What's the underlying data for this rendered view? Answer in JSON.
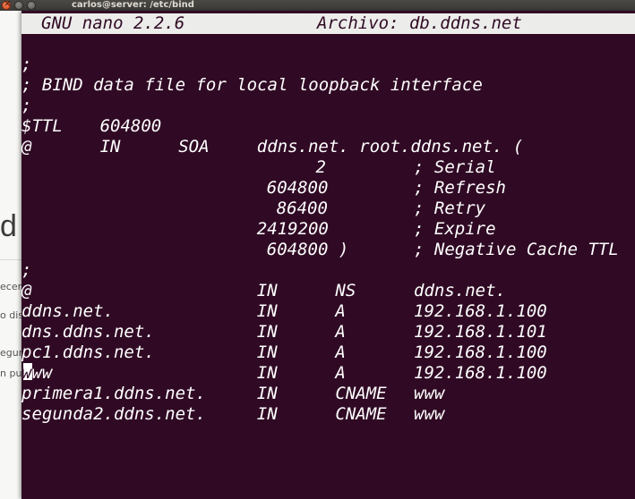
{
  "window": {
    "title": "carlos@server: /etc/bind"
  },
  "background_window": {
    "big_letter": "d",
    "fragments": [
      "ecen",
      "o dis",
      "egun",
      "n pu"
    ]
  },
  "nano": {
    "version": "GNU nano 2.2.6",
    "file_label": "Archivo: db.ddns.net"
  },
  "file_lines": [
    [
      {
        "t": ";",
        "c": 0
      }
    ],
    [
      {
        "t": "; BIND data file for local loopback interface",
        "c": 0
      }
    ],
    [
      {
        "t": ";",
        "c": 0
      }
    ],
    [
      {
        "t": "$TTL",
        "c": 0
      },
      {
        "t": "604800",
        "c": 8
      }
    ],
    [
      {
        "t": "@",
        "c": 0
      },
      {
        "t": "IN",
        "c": 8
      },
      {
        "t": "SOA",
        "c": 16
      },
      {
        "t": "ddns.net. root.ddns.net. (",
        "c": 24
      }
    ],
    [
      {
        "t": "2",
        "c": 30
      },
      {
        "t": "; Serial",
        "c": 40
      }
    ],
    [
      {
        "t": "604800",
        "c": 25
      },
      {
        "t": "; Refresh",
        "c": 40
      }
    ],
    [
      {
        "t": "86400",
        "c": 26
      },
      {
        "t": "; Retry",
        "c": 40
      }
    ],
    [
      {
        "t": "2419200",
        "c": 24
      },
      {
        "t": "; Expire",
        "c": 40
      }
    ],
    [
      {
        "t": "604800 )",
        "c": 25
      },
      {
        "t": "; Negative Cache TTL",
        "c": 40
      }
    ],
    [
      {
        "t": ";",
        "c": 0
      }
    ],
    [
      {
        "t": "@",
        "c": 0
      },
      {
        "t": "IN",
        "c": 24
      },
      {
        "t": "NS",
        "c": 32
      },
      {
        "t": "ddns.net.",
        "c": 40
      }
    ],
    [
      {
        "t": "ddns.net.",
        "c": 0
      },
      {
        "t": "IN",
        "c": 24
      },
      {
        "t": "A",
        "c": 32
      },
      {
        "t": "192.168.1.100",
        "c": 40
      }
    ],
    [
      {
        "t": "dns.ddns.net.",
        "c": 0
      },
      {
        "t": "IN",
        "c": 24
      },
      {
        "t": "A",
        "c": 32
      },
      {
        "t": "192.168.1.101",
        "c": 40
      }
    ],
    [
      {
        "t": "pc1.ddns.net.",
        "c": 0
      },
      {
        "t": "IN",
        "c": 24
      },
      {
        "t": "A",
        "c": 32
      },
      {
        "t": "192.168.1.100",
        "c": 40
      }
    ],
    [
      {
        "t": "www",
        "c": 0,
        "cursor": true
      },
      {
        "t": "IN",
        "c": 24
      },
      {
        "t": "A",
        "c": 32
      },
      {
        "t": "192.168.1.100",
        "c": 40
      }
    ],
    [
      {
        "t": "primera1.ddns.net.",
        "c": 0
      },
      {
        "t": "IN",
        "c": 24
      },
      {
        "t": "CNAME",
        "c": 32
      },
      {
        "t": "www",
        "c": 40
      }
    ],
    [
      {
        "t": "segunda2.ddns.net.",
        "c": 0
      },
      {
        "t": "IN",
        "c": 24
      },
      {
        "t": "CNAME",
        "c": 32
      },
      {
        "t": "www",
        "c": 40
      }
    ]
  ],
  "colors": {
    "terminal_bg": "#300a24",
    "terminal_fg": "#ffffff",
    "header_bg": "#ececea",
    "titlebar_bg": "#3c3b37"
  }
}
